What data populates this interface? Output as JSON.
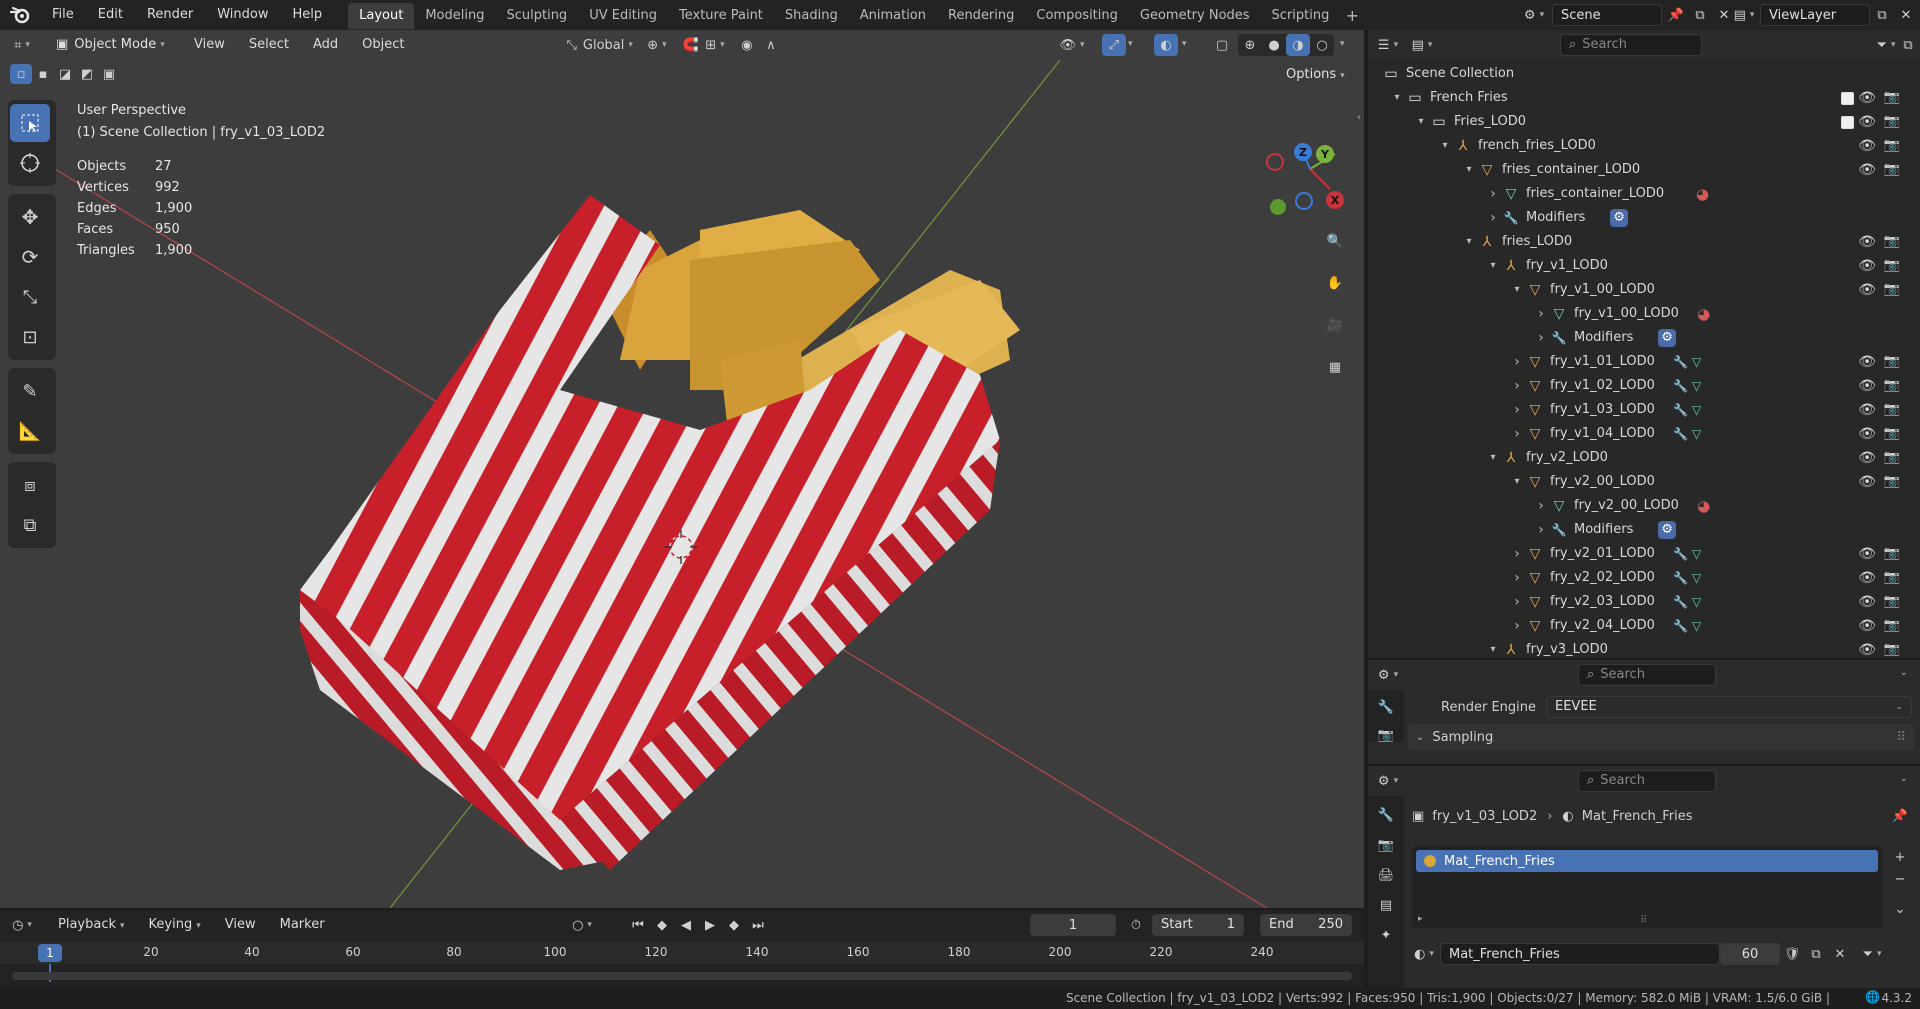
{
  "menus": [
    "File",
    "Edit",
    "Render",
    "Window",
    "Help"
  ],
  "workspaces": [
    "Layout",
    "Modeling",
    "Sculpting",
    "UV Editing",
    "Texture Paint",
    "Shading",
    "Animation",
    "Rendering",
    "Compositing",
    "Geometry Nodes",
    "Scripting"
  ],
  "active_workspace": "Layout",
  "scene": "Scene",
  "view_layer": "ViewLayer",
  "viewport": {
    "mode": "Object Mode",
    "header_menus": [
      "View",
      "Select",
      "Add",
      "Object"
    ],
    "transform_orientation": "Global",
    "options_label": "Options",
    "perspective_label": "User Perspective",
    "collection_label": "(1) Scene Collection | fry_v1_03_LOD2",
    "stats": [
      {
        "label": "Objects",
        "value": "27"
      },
      {
        "label": "Vertices",
        "value": "992"
      },
      {
        "label": "Edges",
        "value": "1,900"
      },
      {
        "label": "Faces",
        "value": "950"
      },
      {
        "label": "Triangles",
        "value": "1,900"
      }
    ],
    "gizmo_axes": [
      "Z",
      "Y",
      "X"
    ]
  },
  "outliner": {
    "search_placeholder": "Search",
    "rows": [
      {
        "label": "Scene Collection",
        "level": 0,
        "icon": "collection",
        "arrow": "",
        "vis": false,
        "chk": false
      },
      {
        "label": "French Fries",
        "level": 1,
        "icon": "collection",
        "arrow": "down",
        "vis": true,
        "chk": true
      },
      {
        "label": "Fries_LOD0",
        "level": 2,
        "icon": "collection",
        "arrow": "down",
        "vis": true,
        "chk": true
      },
      {
        "label": "french_fries_LOD0",
        "level": 3,
        "icon": "empty",
        "arrow": "down",
        "vis": true,
        "chk": false
      },
      {
        "label": "fries_container_LOD0",
        "level": 4,
        "icon": "mesh",
        "arrow": "down",
        "vis": true,
        "chk": false
      },
      {
        "label": "fries_container_LOD0",
        "level": 5,
        "icon": "meshdata",
        "arrow": "right",
        "vis": false,
        "chk": false,
        "extra": "material"
      },
      {
        "label": "Modifiers",
        "level": 5,
        "icon": "wrench",
        "arrow": "right",
        "vis": false,
        "chk": false,
        "extra": "modifier"
      },
      {
        "label": "fries_LOD0",
        "level": 4,
        "icon": "empty",
        "arrow": "down",
        "vis": true,
        "chk": false
      },
      {
        "label": "fry_v1_LOD0",
        "level": 5,
        "icon": "empty",
        "arrow": "down",
        "vis": true,
        "chk": false
      },
      {
        "label": "fry_v1_00_LOD0",
        "level": 6,
        "icon": "mesh",
        "arrow": "down",
        "vis": true,
        "chk": false
      },
      {
        "label": "fry_v1_00_LOD0",
        "level": 7,
        "icon": "meshdata",
        "arrow": "right",
        "vis": false,
        "chk": false,
        "extra": "material"
      },
      {
        "label": "Modifiers",
        "level": 7,
        "icon": "wrench",
        "arrow": "right",
        "vis": false,
        "chk": false,
        "extra": "modifier"
      },
      {
        "label": "fry_v1_01_LOD0",
        "level": 6,
        "icon": "mesh",
        "arrow": "right",
        "vis": true,
        "chk": false,
        "extra": "wrench-mesh"
      },
      {
        "label": "fry_v1_02_LOD0",
        "level": 6,
        "icon": "mesh",
        "arrow": "right",
        "vis": true,
        "chk": false,
        "extra": "wrench-mesh"
      },
      {
        "label": "fry_v1_03_LOD0",
        "level": 6,
        "icon": "mesh",
        "arrow": "right",
        "vis": true,
        "chk": false,
        "extra": "wrench-mesh"
      },
      {
        "label": "fry_v1_04_LOD0",
        "level": 6,
        "icon": "mesh",
        "arrow": "right",
        "vis": true,
        "chk": false,
        "extra": "wrench-mesh"
      },
      {
        "label": "fry_v2_LOD0",
        "level": 5,
        "icon": "empty",
        "arrow": "down",
        "vis": true,
        "chk": false
      },
      {
        "label": "fry_v2_00_LOD0",
        "level": 6,
        "icon": "mesh",
        "arrow": "down",
        "vis": true,
        "chk": false
      },
      {
        "label": "fry_v2_00_LOD0",
        "level": 7,
        "icon": "meshdata",
        "arrow": "right",
        "vis": false,
        "chk": false,
        "extra": "material"
      },
      {
        "label": "Modifiers",
        "level": 7,
        "icon": "wrench",
        "arrow": "right",
        "vis": false,
        "chk": false,
        "extra": "modifier"
      },
      {
        "label": "fry_v2_01_LOD0",
        "level": 6,
        "icon": "mesh",
        "arrow": "right",
        "vis": true,
        "chk": false,
        "extra": "wrench-mesh"
      },
      {
        "label": "fry_v2_02_LOD0",
        "level": 6,
        "icon": "mesh",
        "arrow": "right",
        "vis": true,
        "chk": false,
        "extra": "wrench-mesh"
      },
      {
        "label": "fry_v2_03_LOD0",
        "level": 6,
        "icon": "mesh",
        "arrow": "right",
        "vis": true,
        "chk": false,
        "extra": "wrench-mesh"
      },
      {
        "label": "fry_v2_04_LOD0",
        "level": 6,
        "icon": "mesh",
        "arrow": "right",
        "vis": true,
        "chk": false,
        "extra": "wrench-mesh"
      },
      {
        "label": "fry_v3_LOD0",
        "level": 5,
        "icon": "empty",
        "arrow": "down",
        "vis": true,
        "chk": false
      }
    ]
  },
  "render_props": {
    "search_placeholder": "Search",
    "engine_label": "Render Engine",
    "engine_value": "EEVEE",
    "sampling_label": "Sampling"
  },
  "material_props": {
    "search_placeholder": "Search",
    "object_name": "fry_v1_03_LOD2",
    "material_name": "Mat_French_Fries",
    "slot_name": "Mat_French_Fries",
    "data_name": "Mat_French_Fries",
    "users": "60"
  },
  "timeline": {
    "menus": [
      "Playback",
      "Keying",
      "View",
      "Marker"
    ],
    "current_frame": "1",
    "start_label": "Start",
    "start_value": "1",
    "end_label": "End",
    "end_value": "250",
    "ruler": [
      "1",
      "20",
      "40",
      "60",
      "80",
      "100",
      "120",
      "140",
      "160",
      "180",
      "200",
      "220",
      "240"
    ]
  },
  "status": {
    "text": "Scene Collection | fry_v1_03_LOD2 | Verts:992 | Faces:950 | Tris:1,900 | Objects:0/27 | Memory: 582.0 MiB | VRAM: 1.5/6.0 GiB |",
    "version": "4.3.2"
  },
  "colors": {
    "accent": "#4772b3",
    "box_red": "#c8202a",
    "box_white": "#e6e6e6",
    "fries": "#d8a53a",
    "axis_x": "#c8343e",
    "axis_y": "#7ab33a",
    "axis_z": "#3a7ad8"
  }
}
